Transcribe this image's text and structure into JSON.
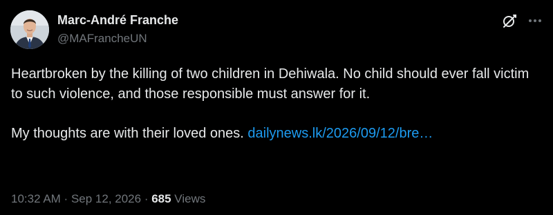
{
  "author": {
    "display_name": "Marc-André Franche",
    "handle": "@MAFrancheUN"
  },
  "header_icons": [
    "grok-icon",
    "more-icon"
  ],
  "tweet": {
    "line1": "Heartbroken by the killing of two children in Dehiwala. No child should ever fall victim to such violence, and those responsible must answer for it.",
    "line2_text": "My thoughts are with their loved ones. ",
    "link_text": "dailynews.lk/2026/09/12/bre…"
  },
  "meta": {
    "time": "10:32 AM",
    "separator": " · ",
    "date": "Sep 12, 2026",
    "views_count": "685",
    "views_label": " Views"
  },
  "colors": {
    "background": "#000000",
    "primary_text": "#e7e9ea",
    "secondary_text": "#71767b",
    "link": "#1d9bf0"
  }
}
